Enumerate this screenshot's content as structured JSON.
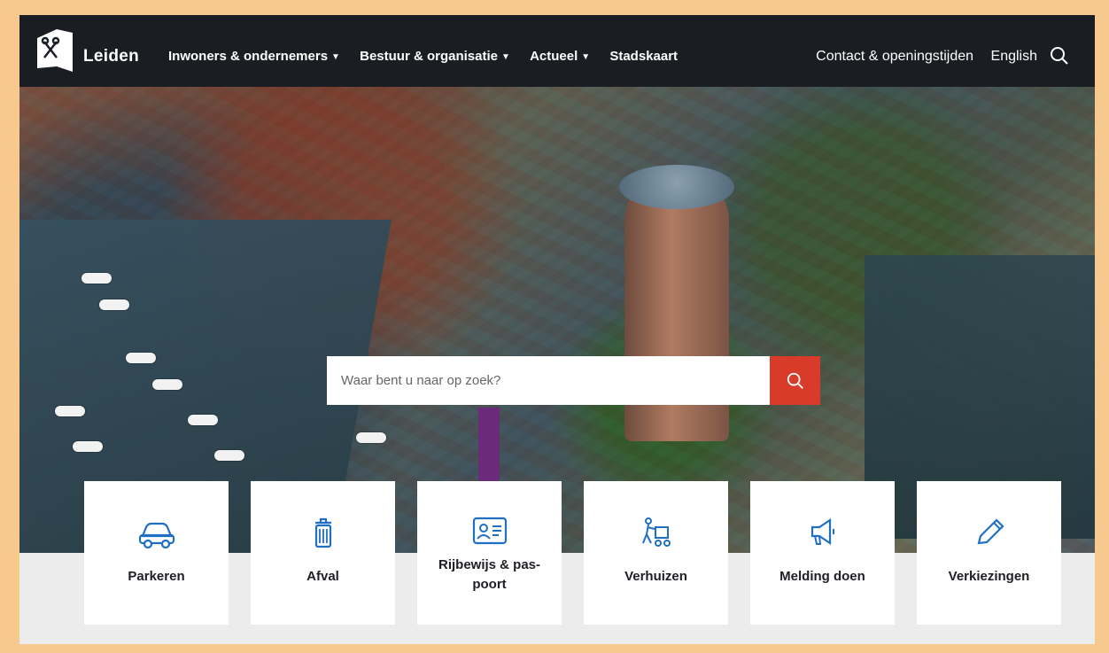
{
  "header": {
    "brand": "Leiden",
    "nav": [
      {
        "label": "Inwoners & ondernemers",
        "has_caret": true
      },
      {
        "label": "Bestuur & organisatie",
        "has_caret": true
      },
      {
        "label": "Actueel",
        "has_caret": true
      },
      {
        "label": "Stadskaart",
        "has_caret": false
      }
    ],
    "right_links": [
      "Contact & openingstijden",
      "English"
    ],
    "search_icon": "search-icon"
  },
  "search": {
    "placeholder": "Waar bent u naar op zoek?",
    "button_icon": "search-icon",
    "accent_color": "#d93b2b"
  },
  "tiles": [
    {
      "label": "Parkeren",
      "icon": "car-icon"
    },
    {
      "label": "Afval",
      "icon": "trash-icon"
    },
    {
      "label": "Rijbewijs & pas-\npoort",
      "icon": "id-card-icon"
    },
    {
      "label": "Verhuizen",
      "icon": "moving-icon"
    },
    {
      "label": "Melding doen",
      "icon": "megaphone-icon"
    },
    {
      "label": "Verkiezingen",
      "icon": "pencil-icon"
    }
  ],
  "colors": {
    "header_bg": "#1a1d22",
    "icon_blue": "#1f6fc5",
    "annotation_arrow": "#6b2b7a",
    "frame_border": "#f7c98f"
  }
}
